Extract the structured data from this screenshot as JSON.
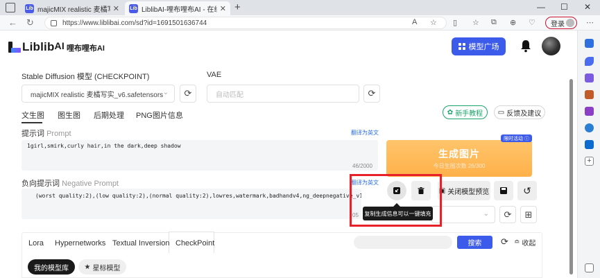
{
  "browser": {
    "tabs": [
      {
        "favicon": "Lib",
        "label": "majicMIX realistic 麦橘写实 | Lib"
      },
      {
        "favicon": "Lib",
        "label": "LiblibAI-哩布哩布AI - 在线stable"
      }
    ],
    "url": "https://www.liblibai.com/sd?id=1691501636744",
    "login_label": "登录"
  },
  "site": {
    "logo_word": "Liblib",
    "logo_ai": "AI",
    "logo_cn": "哩布哩布AI",
    "model_square_label": "模型广场"
  },
  "form": {
    "checkpoint_label": "Stable Diffusion 模型 (CHECKPOINT)",
    "checkpoint_value": "majicMIX realistic 麦橘写实_v6.safetensors",
    "vae_label": "VAE",
    "vae_placeholder": "自动匹配",
    "func_tabs": [
      "文生图",
      "图生图",
      "后期处理",
      "PNG图片信息"
    ],
    "newbie_label": "新手教程",
    "feedback_label": "反馈及建议",
    "prompt_label_cn": "提示词",
    "prompt_label_en": "Prompt",
    "translate_label": "翻译为英文",
    "prompt_value": "1girl,smirk,curly hair,in the dark,deep shadow",
    "prompt_count": "46/2000",
    "negative_label_cn": "负向提示词",
    "negative_label_en": "Negative Prompt",
    "negative_value": "(worst quality:2),(low quality:2),(normal quality:2),lowres,watermark,badhandv4,ng_deepnegative_v1_75t,",
    "negative_count_partial": "05"
  },
  "generate": {
    "button_label": "生成图片",
    "sub_label": "今日生图次数 26/300",
    "badge_label": "限时活动"
  },
  "tools": {
    "close_preview_label": "关闭模型预览",
    "tooltip": "复制生成信息可以一键填充"
  },
  "models": {
    "tabs": [
      "Lora",
      "Hypernetworks",
      "Textual Inversion",
      "CheckPoint"
    ],
    "search_label": "搜索",
    "collapse_label": "收起",
    "my_library_label": "我的模型库",
    "starred_label": "星标模型"
  },
  "colors": {
    "accent_blue": "#3d5bea",
    "generate_orange": "#ffb14a",
    "highlight_red": "#e8202a",
    "green": "#1aa36a"
  }
}
